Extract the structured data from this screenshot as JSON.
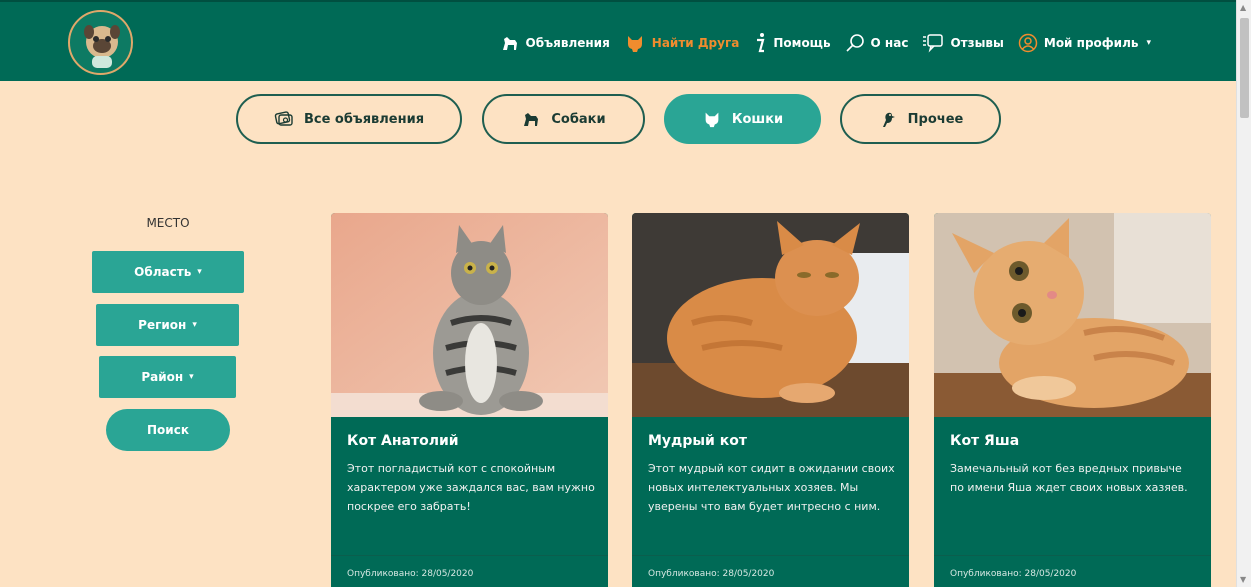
{
  "nav": {
    "items": [
      {
        "label": "Объявления",
        "icon": "dog-icon",
        "active": false
      },
      {
        "label": "Найти Друга",
        "icon": "cat-icon",
        "active": true
      },
      {
        "label": "Помощь",
        "icon": "info-icon",
        "active": false
      },
      {
        "label": "О нас",
        "icon": "search-icon",
        "active": false
      },
      {
        "label": "Отзывы",
        "icon": "chat-icon",
        "active": false
      },
      {
        "label": "Мой профиль",
        "icon": "user-icon",
        "active": false
      }
    ],
    "caret": "▾"
  },
  "tabs": [
    {
      "label": "Все объявления",
      "icon": "tickets-icon"
    },
    {
      "label": "Собаки",
      "icon": "dog-icon"
    },
    {
      "label": "Кошки",
      "icon": "cat-icon"
    },
    {
      "label": "Прочее",
      "icon": "bird-icon"
    }
  ],
  "sidebar": {
    "title": "МЕСТО",
    "region_label": "Область",
    "area_label": "Регион",
    "district_label": "Район",
    "search_label": "Поиск",
    "caret": "▾"
  },
  "cards": [
    {
      "title": "Кот Анатолий",
      "text": "Этот погладистый кот с спокойным характером уже заждался вас, вам нужно поскрее его забрать!",
      "date": "Опубликовано: 28/05/2020"
    },
    {
      "title": "Мудрый кот",
      "text": "Этот мудрый кот сидит в ожидании своих новых интелектуальных хозяев. Мы уверены что вам будет интресно с ним.",
      "date": "Опубликовано: 28/05/2020"
    },
    {
      "title": "Кот Яша",
      "text": "Замечальный кот без вредных привыче по имени Яша ждет своих новых хазяев.",
      "date": "Опубликовано: 28/05/2020"
    }
  ],
  "colors": {
    "header": "#006a56",
    "background": "#fde2c3",
    "accent": "#2aa595",
    "active_nav": "#f08c2e"
  }
}
